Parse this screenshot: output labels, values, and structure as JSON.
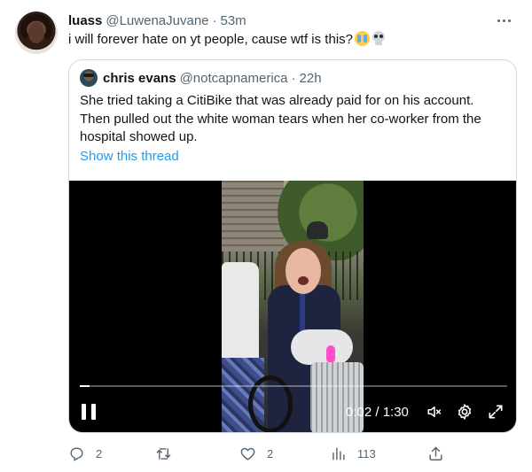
{
  "tweet": {
    "author_name": "luass",
    "author_handle": "@LuwenaJuvane",
    "separator": "·",
    "time": "53m",
    "text": "i will forever hate on yt people, cause wtf is this?",
    "emojis": [
      "loudly-crying-face",
      "skull"
    ]
  },
  "quote": {
    "author_name": "chris evans",
    "author_handle": "@notcapnamerica",
    "separator": "·",
    "time": "22h",
    "text": "She tried taking a CitiBike that was already paid for on his account. Then pulled out the white woman tears when her co-worker from the hospital showed up.",
    "show_thread_label": "Show this thread",
    "video": {
      "time_display": "0:02 / 1:30",
      "progress": 0.022,
      "controls": [
        "pause-icon",
        "volume-muted-icon",
        "settings-icon",
        "fullscreen-icon"
      ]
    }
  },
  "actions": {
    "reply_count": "2",
    "retweet_count": "",
    "like_count": "2",
    "view_count": "113"
  },
  "colors": {
    "accent": "#1d9bf0",
    "secondary_text": "#536471",
    "border": "#cfd9de"
  }
}
